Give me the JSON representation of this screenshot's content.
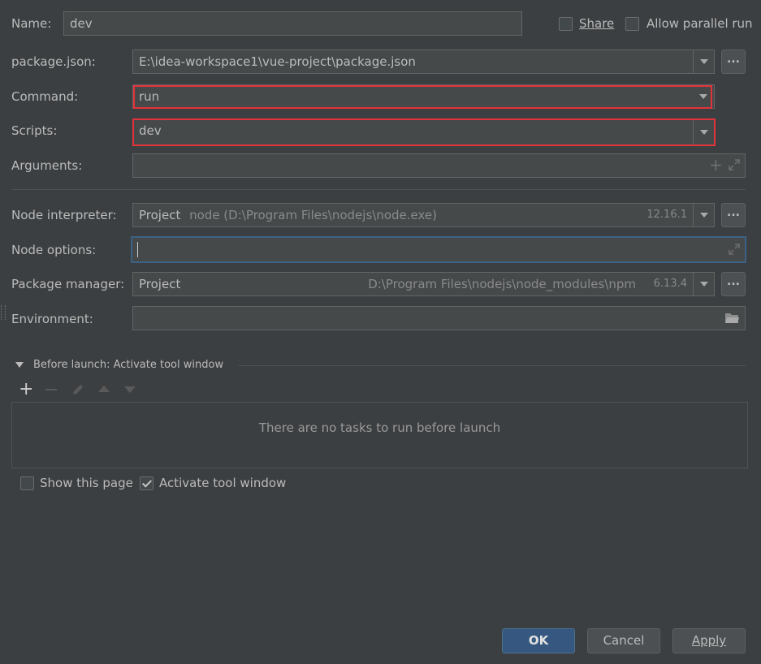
{
  "name": {
    "label": "Name:",
    "value": "dev"
  },
  "share": {
    "label": "Share",
    "checked": false
  },
  "parallel": {
    "label": "Allow parallel run",
    "checked": false
  },
  "package_json": {
    "label": "package.json:",
    "value": "E:\\idea-workspace1\\vue-project\\package.json",
    "browse": "..."
  },
  "command": {
    "label": "Command:",
    "value": "run"
  },
  "scripts": {
    "label": "Scripts:",
    "value": "dev"
  },
  "arguments": {
    "label": "Arguments:",
    "value": ""
  },
  "node_interpreter": {
    "label": "Node interpreter:",
    "kind": "Project",
    "path": "node (D:\\Program Files\\nodejs\\node.exe)",
    "version": "12.16.1",
    "browse": "..."
  },
  "node_options": {
    "label": "Node options:",
    "value": ""
  },
  "package_manager": {
    "label": "Package manager:",
    "kind": "Project",
    "path": "D:\\Program Files\\nodejs\\node_modules\\npm",
    "version": "6.13.4",
    "browse": "..."
  },
  "environment": {
    "label": "Environment:",
    "value": ""
  },
  "before_launch": {
    "title": "Before launch: Activate tool window",
    "empty_text": "There are no tasks to run before launch",
    "toolbar": [
      "add-icon",
      "remove-icon",
      "edit-icon",
      "move-up-icon",
      "move-down-icon"
    ]
  },
  "show_page": {
    "label": "Show this page",
    "checked": false
  },
  "activate_tool": {
    "label": "Activate tool window",
    "checked": true
  },
  "buttons": {
    "ok": "OK",
    "cancel": "Cancel",
    "apply": "Apply"
  },
  "colors": {
    "background": "#3c3f41",
    "field": "#45494a",
    "highlight": "#e3333a",
    "focus": "#3d6185",
    "primary": "#365880"
  }
}
